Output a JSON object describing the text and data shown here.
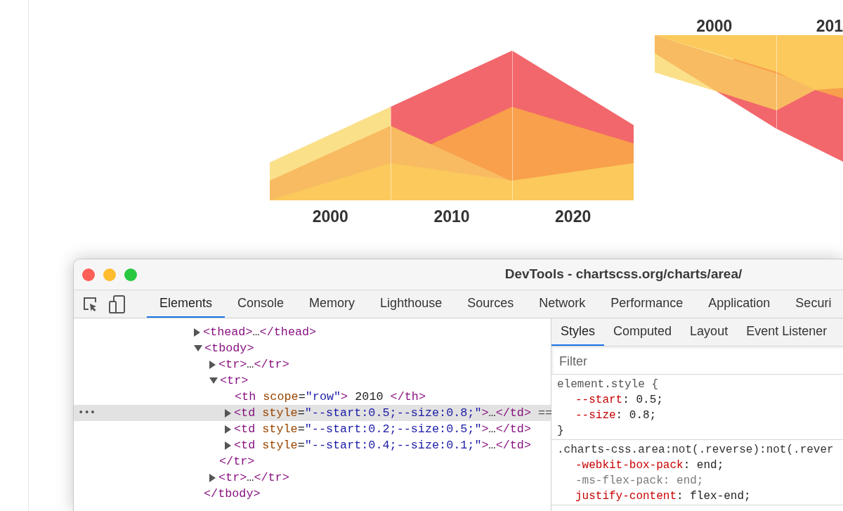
{
  "page": {
    "charts": [
      {
        "kind": "picture",
        "labels": [
          "2000",
          "2010",
          "2020"
        ]
      },
      {
        "kind": "picture",
        "labels": [
          "2000",
          "201"
        ]
      }
    ]
  },
  "devtools": {
    "window": {
      "title": "DevTools - chartscss.org/charts/area/"
    },
    "tabs": [
      {
        "label": "Elements",
        "selected": true
      },
      {
        "label": "Console",
        "selected": false
      },
      {
        "label": "Memory",
        "selected": false
      },
      {
        "label": "Lighthouse",
        "selected": false
      },
      {
        "label": "Sources",
        "selected": false
      },
      {
        "label": "Network",
        "selected": false
      },
      {
        "label": "Performance",
        "selected": false
      },
      {
        "label": "Application",
        "selected": false
      },
      {
        "label": "Securi",
        "selected": false
      }
    ],
    "dom_tree": [
      {
        "code": "<thead>…</thead>",
        "expanded": false,
        "selected": false
      },
      {
        "code": "<tbody>",
        "expanded": true,
        "selected": false,
        "children": [
          {
            "code": "<tr>…</tr>",
            "expanded": false,
            "selected": false
          },
          {
            "code": "<tr>",
            "expanded": true,
            "selected": false,
            "children": [
              {
                "code": "<th scope=\"row\"> 2010 </th>",
                "selected": false
              },
              {
                "code": "<td style=\"--start:0.5;--size:0.8;\">…</td>",
                "expanded": false,
                "selected": true,
                "gutter": "•••",
                "suffix": "=="
              },
              {
                "code": "<td style=\"--start:0.2;--size:0.5;\">…</td>",
                "expanded": false,
                "selected": false
              },
              {
                "code": "<td style=\"--start:0.4;--size:0.1;\">…</td>",
                "expanded": false,
                "selected": false
              }
            ],
            "closing": "</tr>"
          },
          {
            "code": "<tr>…</tr>",
            "expanded": false,
            "selected": false
          }
        ],
        "closing": "</tbody>"
      }
    ],
    "sidebar_tabs": [
      {
        "label": "Styles",
        "selected": true
      },
      {
        "label": "Computed",
        "selected": false
      },
      {
        "label": "Layout",
        "selected": false
      },
      {
        "label": "Event Listener",
        "selected": false
      }
    ],
    "filter": {
      "placeholder": "Filter"
    },
    "style_rules": [
      {
        "selector": "element.style {",
        "properties": [
          {
            "text": "--start: 0.5;",
            "overridden": false
          },
          {
            "text": "--size: 0.8;",
            "overridden": false
          }
        ],
        "closing": "}"
      },
      {
        "selector": ".charts-css.area:not(.reverse):not(.rever",
        "properties": [
          {
            "text": "-webkit-box-pack: end;",
            "overridden": false
          },
          {
            "text": "-ms-flex-pack: end;",
            "overridden": true
          },
          {
            "text": "justify-content: flex-end;",
            "overridden": false
          }
        ]
      }
    ]
  }
}
